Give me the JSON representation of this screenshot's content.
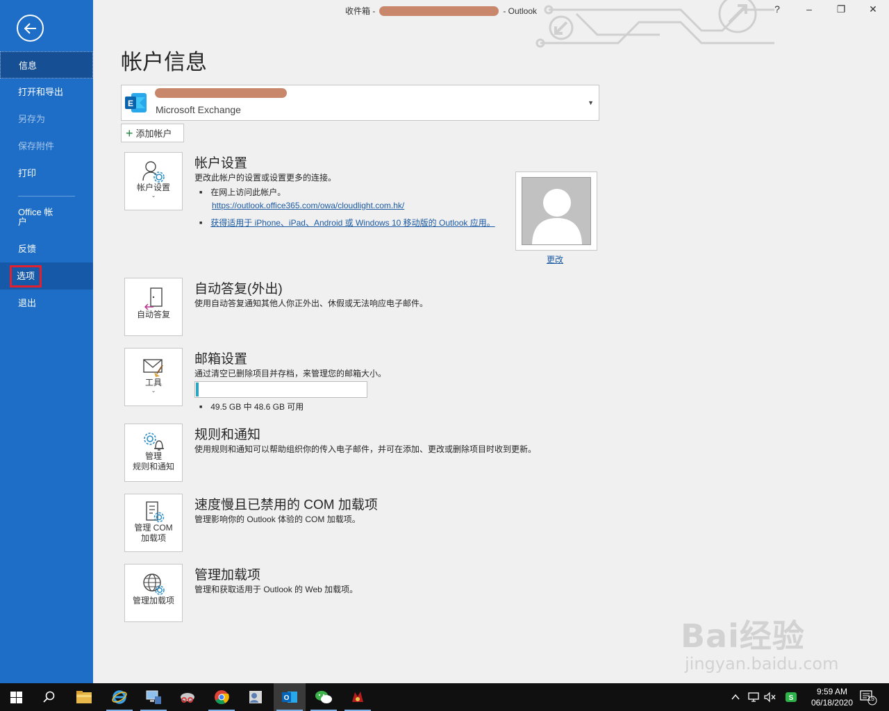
{
  "window": {
    "title_prefix": "收件箱 -",
    "title_suffix": "- Outlook",
    "help": "?",
    "minimize": "–",
    "restore": "❐",
    "close": "✕"
  },
  "sidebar": {
    "items": [
      {
        "label": "信息",
        "state": "active"
      },
      {
        "label": "打开和导出",
        "state": "normal"
      },
      {
        "label": "另存为",
        "state": "disabled"
      },
      {
        "label": "保存附件",
        "state": "disabled"
      },
      {
        "label": "打印",
        "state": "normal"
      },
      {
        "label": "Office 帐户",
        "state": "normal"
      },
      {
        "label": "反馈",
        "state": "normal"
      },
      {
        "label": "选项",
        "state": "selected"
      },
      {
        "label": "退出",
        "state": "normal"
      }
    ]
  },
  "main": {
    "page_title": "帐户信息",
    "account": {
      "type": "Microsoft Exchange"
    },
    "add_account_label": "添加帐户",
    "sections": {
      "account_settings": {
        "tile_label": "帐户设置",
        "title": "帐户设置",
        "description": "更改此帐户的设置或设置更多的连接。",
        "bullet1": "在网上访问此帐户。",
        "link1": "https://outlook.office365.com/owa/cloudlight.com.hk/",
        "link2": "获得适用于 iPhone、iPad、Android 或 Windows 10 移动版的 Outlook 应用。",
        "change_photo": "更改"
      },
      "auto_reply": {
        "tile_label": "自动答复",
        "title": "自动答复(外出)",
        "description": "使用自动答复通知其他人你正外出、休假或无法响应电子邮件。"
      },
      "mailbox": {
        "tile_label": "工具",
        "title": "邮箱设置",
        "description": "通过清空已删除项目并存档，来管理您的邮箱大小。",
        "usage_text": "49.5 GB 中 48.6 GB 可用",
        "used_fraction": 0.018
      },
      "rules": {
        "tile_label_1": "管理",
        "tile_label_2": "规则和通知",
        "title": "规则和通知",
        "description": "使用规则和通知可以帮助组织你的传入电子邮件，并可在添加、更改或删除项目时收到更新。"
      },
      "com_addins": {
        "tile_label_1": "管理 COM",
        "tile_label_2": "加载项",
        "title": "速度慢且已禁用的 COM 加载项",
        "description": "管理影响你的 Outlook 体验的 COM 加载项。"
      },
      "addins": {
        "tile_label": "管理加载项",
        "title": "管理加载项",
        "description": "管理和获取适用于 Outlook 的 Web 加载项。"
      }
    }
  },
  "watermark": {
    "brand": "Bai经验",
    "url": "jingyan.baidu.com"
  },
  "taskbar": {
    "time": "9:59 AM",
    "date": "06/18/2020",
    "notification_count": "15",
    "apps": [
      "start-icon",
      "search-icon",
      "file-explorer-icon",
      "internet-explorer-icon",
      "network-computer-icon",
      "snipping-tool-icon",
      "chrome-icon",
      "people-icon",
      "outlook-icon",
      "wechat-icon",
      "game-icon"
    ]
  },
  "colors": {
    "sidebar": "#1e6ec8",
    "sidebar_active": "#164f93",
    "highlight": "#e5202e",
    "link": "#1b5aa3",
    "mailbox_bar": "#2fa5c6"
  }
}
